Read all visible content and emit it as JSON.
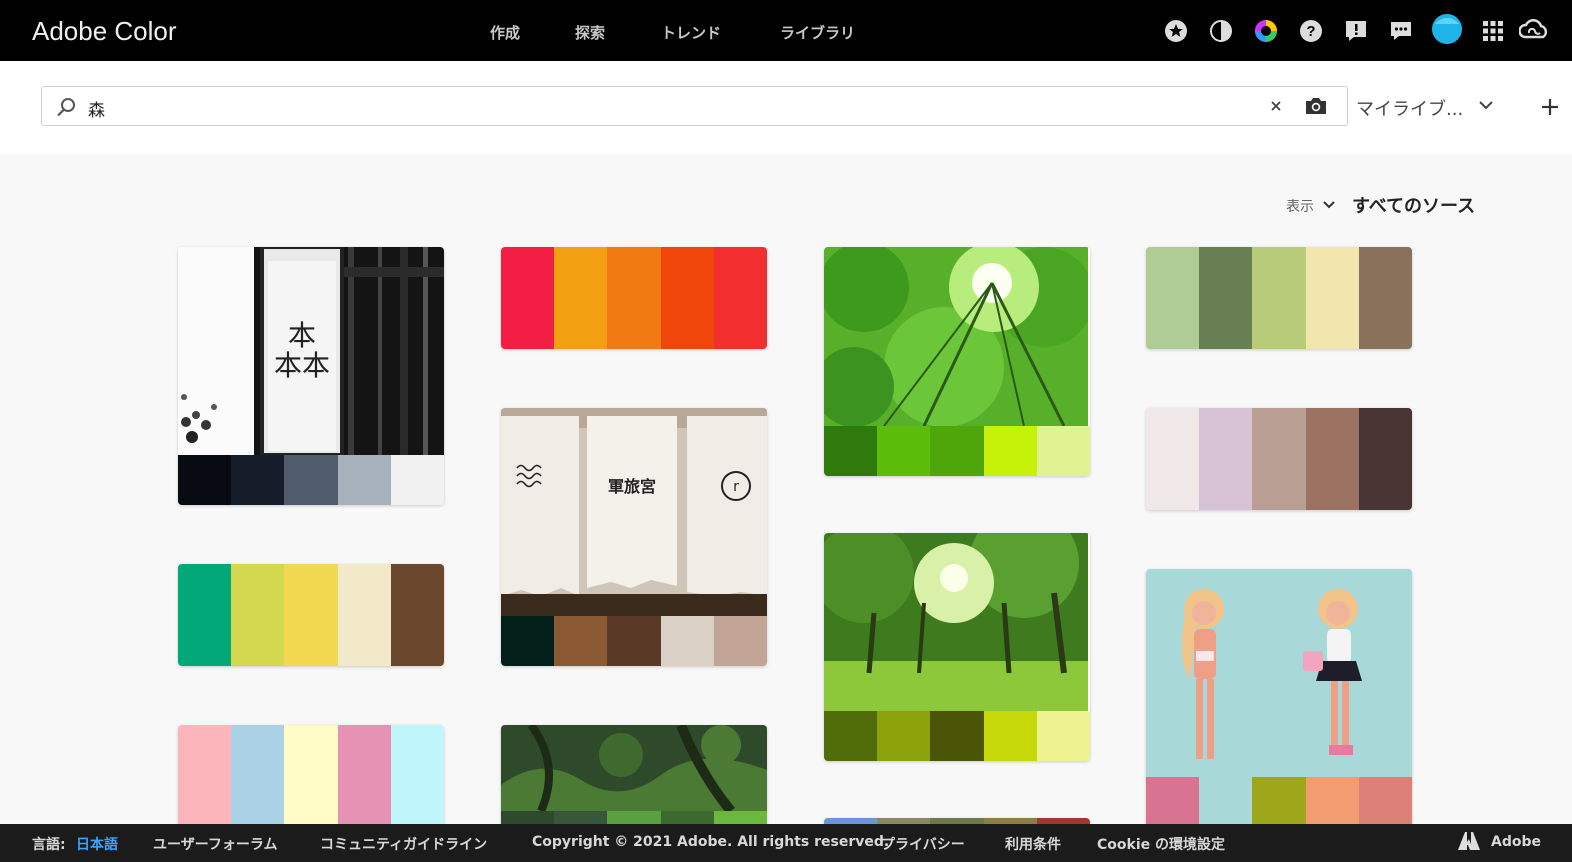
{
  "app": {
    "title": "Adobe Color"
  },
  "nav": {
    "create": "作成",
    "explore": "探索",
    "trends": "トレンド",
    "libraries": "ライブラリ"
  },
  "search": {
    "query": "森",
    "library_select": "マイライブ..."
  },
  "filter": {
    "view_label": "表示",
    "source_value": "すべてのソース"
  },
  "cards": [
    {
      "swatches": [
        "#080c12",
        "#151c2a",
        "#505c6c",
        "#a7b2bd",
        "#f1f1f1"
      ]
    },
    {
      "swatches": [
        "#f21e44",
        "#f2a011",
        "#f27a12",
        "#f1460b",
        "#f22f2f"
      ]
    },
    {
      "swatches": [
        "#2f7a0d",
        "#5bbc0a",
        "#4fa60a",
        "#c5f208",
        "#e0f291"
      ]
    },
    {
      "swatches": [
        "#b0cc96",
        "#687f54",
        "#b8cb7a",
        "#f2e6ae",
        "#8a715c"
      ]
    },
    {
      "swatches": [
        "#03211a",
        "#8b5a34",
        "#5a3a26",
        "#dbd0c5",
        "#c2a597"
      ]
    },
    {
      "swatches": [
        "#f1e8ea",
        "#d8c2d6",
        "#b99e94",
        "#9c7262",
        "#4a3535"
      ]
    },
    {
      "swatches": [
        "#03a878",
        "#d3d84e",
        "#f2d751",
        "#f2e9c9",
        "#6b482d"
      ]
    },
    {
      "swatches": [
        "#506d0a",
        "#8ba20a",
        "#4a5507",
        "#c7d90a",
        "#eef290"
      ]
    },
    {
      "swatches": [
        "#d97392",
        "#a8d8d8",
        "#9ea71a",
        "#f29c72",
        "#db8177"
      ]
    },
    {
      "swatches": [
        "#fbb5bb",
        "#aad1e6",
        "#fffbc6",
        "#e592b4",
        "#bff5fb"
      ]
    },
    {
      "swatches": [
        "#2d4a2e",
        "#38563a",
        "#5aa040",
        "#3b6a2e",
        "#6bb83e"
      ]
    },
    {
      "swatches": [
        "#6a96d8",
        "#8a8a62",
        "#6f7b46",
        "#8c7e3e",
        "#9a3b32"
      ]
    }
  ],
  "footer": {
    "language_label": "言語:",
    "language_value": "日本語",
    "forum": "ユーザーフォーラム",
    "guidelines": "コミュニティガイドライン",
    "copyright": "Copyright © 2021 Adobe. All rights reserved.",
    "privacy": "プライバシー",
    "terms": "利用条件",
    "cookie": "Cookie の環境設定",
    "adobe": "Adobe"
  }
}
